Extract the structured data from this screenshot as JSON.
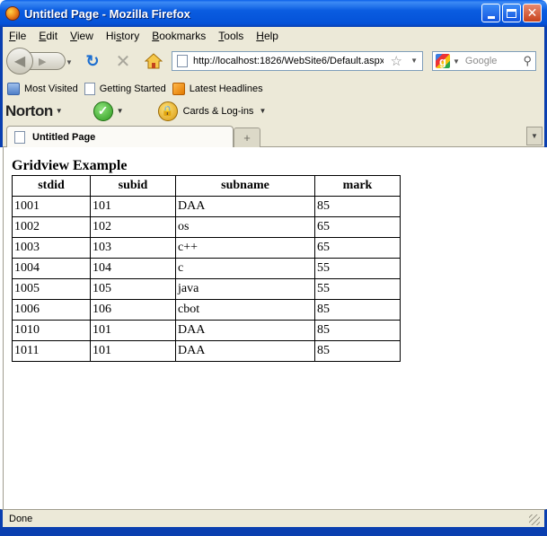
{
  "window": {
    "title": "Untitled Page - Mozilla Firefox"
  },
  "menu": [
    {
      "key": "F",
      "rest": "ile"
    },
    {
      "key": "E",
      "rest": "dit"
    },
    {
      "key": "V",
      "rest": "iew"
    },
    {
      "key": "",
      "pre": "Hi",
      "key2": "s",
      "rest": "tory"
    },
    {
      "key": "B",
      "rest": "ookmarks"
    },
    {
      "key": "T",
      "rest": "ools"
    },
    {
      "key": "H",
      "rest": "elp"
    }
  ],
  "nav": {
    "url": "http://localhost:1826/WebSite6/Default.aspx",
    "search_placeholder": "Google"
  },
  "bookmarks": [
    {
      "label": "Most Visited",
      "icon": "most-visited-icon"
    },
    {
      "label": "Getting Started",
      "icon": "page-icon"
    },
    {
      "label": "Latest Headlines",
      "icon": "rss-icon"
    }
  ],
  "norton": {
    "logo": "Norton",
    "cards_label": "Cards & Log-ins"
  },
  "tab": {
    "label": "Untitled Page",
    "new_tab_glyph": "+"
  },
  "page": {
    "heading": "Gridview Example",
    "columns": [
      "stdid",
      "subid",
      "subname",
      "mark"
    ],
    "rows": [
      [
        "1001",
        "101",
        "DAA",
        "85"
      ],
      [
        "1002",
        "102",
        "os",
        "65"
      ],
      [
        "1003",
        "103",
        "c++",
        "65"
      ],
      [
        "1004",
        "104",
        "c",
        "55"
      ],
      [
        "1005",
        "105",
        "java",
        "55"
      ],
      [
        "1006",
        "106",
        "cbot",
        "85"
      ],
      [
        "1010",
        "101",
        "DAA",
        "85"
      ],
      [
        "1011",
        "101",
        "DAA",
        "85"
      ]
    ]
  },
  "status": {
    "text": "Done"
  }
}
